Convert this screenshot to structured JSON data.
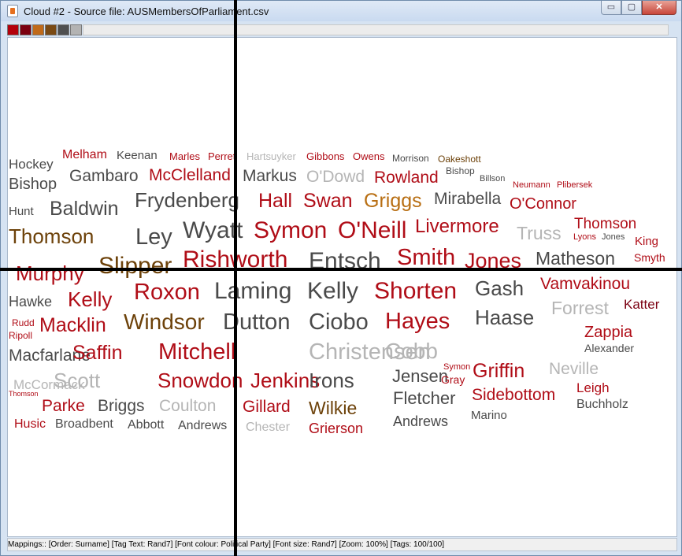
{
  "window": {
    "title": "Cloud #2 - Source file: AUSMembersOfParliament.csv",
    "buttons": {
      "minimize": "▭",
      "maximize": "▢",
      "close": "✕"
    }
  },
  "swatches": [
    "#b3000a",
    "#7b0010",
    "#c06a1a",
    "#7a4a14",
    "#505050",
    "#b3b3b3"
  ],
  "colors": {
    "red": "#b00d17",
    "darkred": "#7b0012",
    "brown": "#6d420a",
    "orange": "#b86e12",
    "gray": "#4a4a4a",
    "lightgray": "#b5b5b5"
  },
  "words": [
    {
      "text": "Hockey",
      "color": "gray"
    },
    {
      "text": "Melham",
      "color": "red"
    },
    {
      "text": "Keenan",
      "color": "gray"
    },
    {
      "text": "Marles",
      "color": "red"
    },
    {
      "text": "Perret",
      "color": "red"
    },
    {
      "text": "Hartsuyker",
      "color": "lightgray"
    },
    {
      "text": "Gibbons",
      "color": "red"
    },
    {
      "text": "Owens",
      "color": "red"
    },
    {
      "text": "Morrison",
      "color": "gray"
    },
    {
      "text": "Oakeshott",
      "color": "brown"
    },
    {
      "text": "Bishop",
      "color": "gray"
    },
    {
      "text": "Gambaro",
      "color": "gray"
    },
    {
      "text": "McClelland",
      "color": "red"
    },
    {
      "text": "Markus",
      "color": "gray"
    },
    {
      "text": "O'Dowd",
      "color": "lightgray"
    },
    {
      "text": "Rowland",
      "color": "red"
    },
    {
      "text": "Bishop",
      "color": "gray"
    },
    {
      "text": "Billson",
      "color": "gray"
    },
    {
      "text": "Neumann",
      "color": "red"
    },
    {
      "text": "Plibersek",
      "color": "red"
    },
    {
      "text": "Hunt",
      "color": "gray"
    },
    {
      "text": "Baldwin",
      "color": "gray"
    },
    {
      "text": "Frydenberg",
      "color": "gray"
    },
    {
      "text": "Hall",
      "color": "red"
    },
    {
      "text": "Swan",
      "color": "red"
    },
    {
      "text": "Griggs",
      "color": "orange"
    },
    {
      "text": "Mirabella",
      "color": "gray"
    },
    {
      "text": "O'Connor",
      "color": "red"
    },
    {
      "text": "Thomson",
      "color": "brown"
    },
    {
      "text": "Ley",
      "color": "gray"
    },
    {
      "text": "Wyatt",
      "color": "gray"
    },
    {
      "text": "Symon",
      "color": "red"
    },
    {
      "text": "O'Neill",
      "color": "red"
    },
    {
      "text": "Livermore",
      "color": "red"
    },
    {
      "text": "Truss",
      "color": "lightgray"
    },
    {
      "text": "Thomson",
      "color": "red"
    },
    {
      "text": "Lyons",
      "color": "red"
    },
    {
      "text": "Jones",
      "color": "gray"
    },
    {
      "text": "King",
      "color": "red"
    },
    {
      "text": "Murphy",
      "color": "red"
    },
    {
      "text": "Slipper",
      "color": "brown"
    },
    {
      "text": "Rishworth",
      "color": "red"
    },
    {
      "text": "Entsch",
      "color": "gray"
    },
    {
      "text": "Smith",
      "color": "red"
    },
    {
      "text": "Jones",
      "color": "red"
    },
    {
      "text": "Matheson",
      "color": "gray"
    },
    {
      "text": "Smyth",
      "color": "red"
    },
    {
      "text": "Hawke",
      "color": "gray"
    },
    {
      "text": "Kelly",
      "color": "red"
    },
    {
      "text": "Roxon",
      "color": "red"
    },
    {
      "text": "Laming",
      "color": "gray"
    },
    {
      "text": "Kelly",
      "color": "gray"
    },
    {
      "text": "Shorten",
      "color": "red"
    },
    {
      "text": "Gash",
      "color": "gray"
    },
    {
      "text": "Vamvakinou",
      "color": "red"
    },
    {
      "text": "Forrest",
      "color": "lightgray"
    },
    {
      "text": "Katter",
      "color": "darkred"
    },
    {
      "text": "Rudd",
      "color": "red"
    },
    {
      "text": "Ripoll",
      "color": "red"
    },
    {
      "text": "Macklin",
      "color": "red"
    },
    {
      "text": "Windsor",
      "color": "brown"
    },
    {
      "text": "Dutton",
      "color": "gray"
    },
    {
      "text": "Ciobo",
      "color": "gray"
    },
    {
      "text": "Hayes",
      "color": "red"
    },
    {
      "text": "Haase",
      "color": "gray"
    },
    {
      "text": "Zappia",
      "color": "red"
    },
    {
      "text": "Alexander",
      "color": "gray"
    },
    {
      "text": "Macfarlane",
      "color": "gray"
    },
    {
      "text": "Saffin",
      "color": "red"
    },
    {
      "text": "Mitchell",
      "color": "red"
    },
    {
      "text": "Christensen",
      "color": "lightgray"
    },
    {
      "text": "Cobb",
      "color": "lightgray"
    },
    {
      "text": "Symon",
      "color": "red"
    },
    {
      "text": "Griffin",
      "color": "red"
    },
    {
      "text": "Neville",
      "color": "lightgray"
    },
    {
      "text": "McCormack",
      "color": "lightgray"
    },
    {
      "text": "Scott",
      "color": "lightgray"
    },
    {
      "text": "Snowdon",
      "color": "red"
    },
    {
      "text": "Jenkins",
      "color": "red"
    },
    {
      "text": "Irons",
      "color": "gray"
    },
    {
      "text": "Jensen",
      "color": "gray"
    },
    {
      "text": "Gray",
      "color": "red"
    },
    {
      "text": "Leigh",
      "color": "red"
    },
    {
      "text": "Thomson",
      "color": "red"
    },
    {
      "text": "Fletcher",
      "color": "gray"
    },
    {
      "text": "Sidebottom",
      "color": "red"
    },
    {
      "text": "Parke",
      "color": "red"
    },
    {
      "text": "Briggs",
      "color": "gray"
    },
    {
      "text": "Coulton",
      "color": "lightgray"
    },
    {
      "text": "Gillard",
      "color": "red"
    },
    {
      "text": "Wilkie",
      "color": "brown"
    },
    {
      "text": "Buchholz",
      "color": "gray"
    },
    {
      "text": "Marino",
      "color": "gray"
    },
    {
      "text": "Husic",
      "color": "red"
    },
    {
      "text": "Broadbent",
      "color": "gray"
    },
    {
      "text": "Abbott",
      "color": "gray"
    },
    {
      "text": "Andrews",
      "color": "gray"
    },
    {
      "text": "Chester",
      "color": "lightgray"
    },
    {
      "text": "Grierson",
      "color": "red"
    },
    {
      "text": "Andrews",
      "color": "gray"
    }
  ],
  "status": "Mappings:: [Order: Surname]  [Tag Text: Rand7]  [Font colour: Political Party]  [Font size: Rand7]  [Zoom: 100%]  [Tags: 100/100]"
}
